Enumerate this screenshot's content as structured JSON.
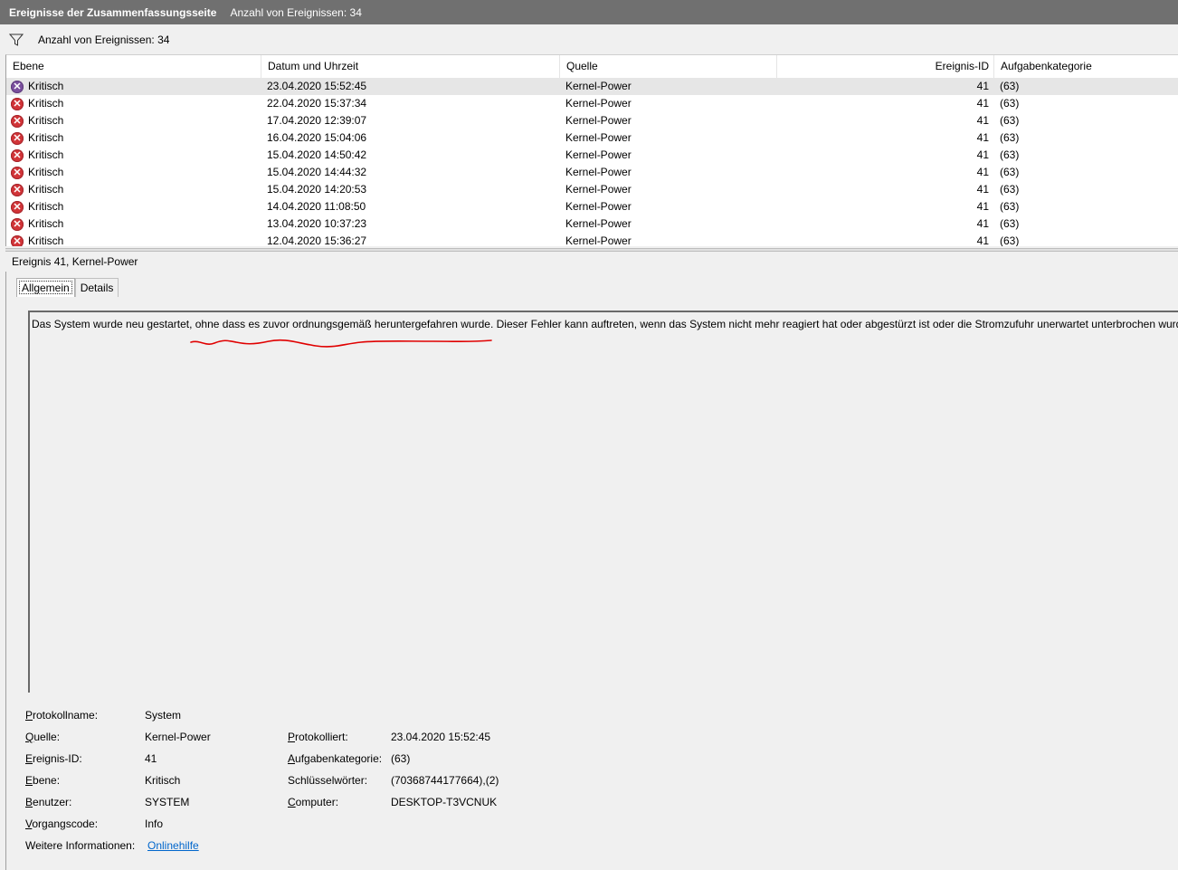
{
  "titlebar": {
    "title": "Ereignisse der Zusammenfassungsseite",
    "count": "Anzahl von Ereignissen: 34"
  },
  "filter": {
    "icon": "filter-icon",
    "text": "Anzahl von Ereignissen: 34"
  },
  "table": {
    "headers": {
      "level": "Ebene",
      "date": "Datum und Uhrzeit",
      "source": "Quelle",
      "id": "Ereignis-ID",
      "category": "Aufgabenkategorie"
    },
    "rows": [
      {
        "level": "Kritisch",
        "date": "23.04.2020 15:52:45",
        "source": "Kernel-Power",
        "id": "41",
        "category": "(63)"
      },
      {
        "level": "Kritisch",
        "date": "22.04.2020 15:37:34",
        "source": "Kernel-Power",
        "id": "41",
        "category": "(63)"
      },
      {
        "level": "Kritisch",
        "date": "17.04.2020 12:39:07",
        "source": "Kernel-Power",
        "id": "41",
        "category": "(63)"
      },
      {
        "level": "Kritisch",
        "date": "16.04.2020 15:04:06",
        "source": "Kernel-Power",
        "id": "41",
        "category": "(63)"
      },
      {
        "level": "Kritisch",
        "date": "15.04.2020 14:50:42",
        "source": "Kernel-Power",
        "id": "41",
        "category": "(63)"
      },
      {
        "level": "Kritisch",
        "date": "15.04.2020 14:44:32",
        "source": "Kernel-Power",
        "id": "41",
        "category": "(63)"
      },
      {
        "level": "Kritisch",
        "date": "15.04.2020 14:20:53",
        "source": "Kernel-Power",
        "id": "41",
        "category": "(63)"
      },
      {
        "level": "Kritisch",
        "date": "14.04.2020 11:08:50",
        "source": "Kernel-Power",
        "id": "41",
        "category": "(63)"
      },
      {
        "level": "Kritisch",
        "date": "13.04.2020 10:37:23",
        "source": "Kernel-Power",
        "id": "41",
        "category": "(63)"
      },
      {
        "level": "Kritisch",
        "date": "12.04.2020 15:36:27",
        "source": "Kernel-Power",
        "id": "41",
        "category": "(63)"
      }
    ]
  },
  "detail": {
    "title": "Ereignis 41, Kernel-Power",
    "tabs": [
      "Allgemein",
      "Details"
    ],
    "description": "Das System wurde neu gestartet, ohne dass es zuvor ordnungsgemäß heruntergefahren wurde. Dieser Fehler kann auftreten, wenn das System nicht mehr reagiert hat oder abgestürzt ist oder die Stromzufuhr unerwartet unterbrochen wurde.",
    "annotation_color": "#e00000",
    "props": {
      "log_name_label": "Protokollname:",
      "log_name": "System",
      "source_label": "Quelle:",
      "source": "Kernel-Power",
      "logged_label": "Protokolliert:",
      "logged": "23.04.2020 15:52:45",
      "event_id_label": "Ereignis-ID:",
      "event_id": "41",
      "task_cat_label": "Aufgabenkategorie:",
      "task_cat": "(63)",
      "level_label": "Ebene:",
      "level": "Kritisch",
      "keywords_label": "Schlüsselwörter:",
      "keywords": "(70368744177664),(2)",
      "user_label": "Benutzer:",
      "user": "SYSTEM",
      "computer_label": "Computer:",
      "computer": "DESKTOP-T3VCNUK",
      "opcode_label": "Vorgangscode:",
      "opcode": "Info",
      "more_info_label": "Weitere Informationen:",
      "more_info_link": "Onlinehilfe"
    }
  }
}
